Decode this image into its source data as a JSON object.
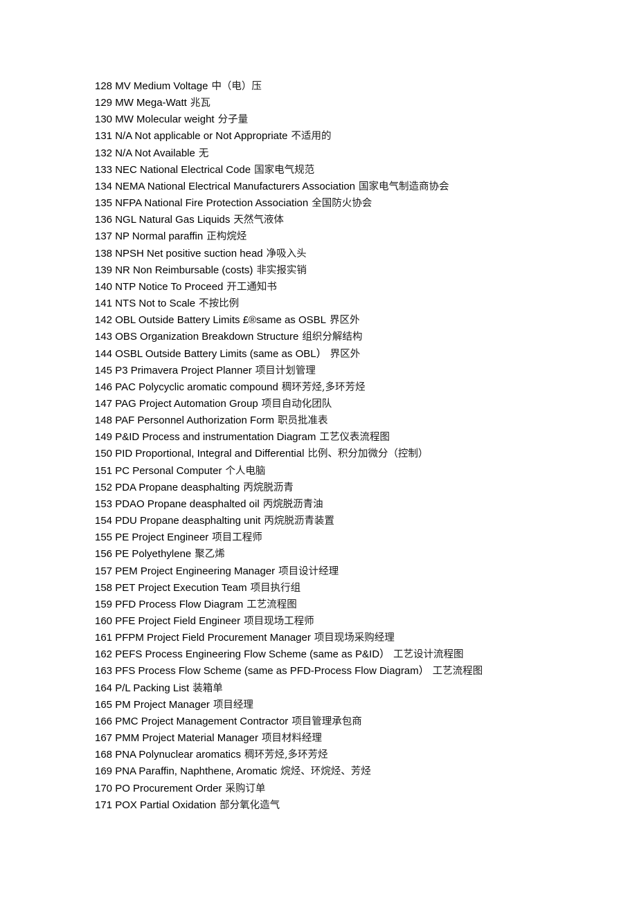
{
  "document": {
    "type": "bilingual-abbreviation-glossary",
    "language_pair": "English-Chinese",
    "first_index": 128,
    "last_index": 171,
    "entry_count": 44
  },
  "entries": [
    {
      "num": "128",
      "term": "MV Medium Voltage",
      "cn": "中（电）压"
    },
    {
      "num": "129",
      "term": "MW Mega-Watt",
      "cn": "兆瓦"
    },
    {
      "num": "130",
      "term": "MW Molecular weight",
      "cn": "分子量"
    },
    {
      "num": "131",
      "term": "N/A Not applicable or Not Appropriate",
      "cn": "不适用的"
    },
    {
      "num": "132",
      "term": "N/A Not Available",
      "cn": "无"
    },
    {
      "num": "133",
      "term": "NEC National Electrical Code",
      "cn": "国家电气规范"
    },
    {
      "num": "134",
      "term": "NEMA National Electrical Manufacturers Association",
      "cn": "国家电气制造商协会"
    },
    {
      "num": "135",
      "term": "NFPA National Fire Protection Association",
      "cn": "全国防火协会"
    },
    {
      "num": "136",
      "term": "NGL Natural Gas Liquids",
      "cn": "天然气液体"
    },
    {
      "num": "137",
      "term": "NP Normal paraffin",
      "cn": "正构烷烃"
    },
    {
      "num": "138",
      "term": "NPSH Net positive suction head",
      "cn": "净吸入头"
    },
    {
      "num": "139",
      "term": "NR Non Reimbursable (costs)",
      "cn": "非实报实销"
    },
    {
      "num": "140",
      "term": "NTP Notice To Proceed",
      "cn": "开工通知书"
    },
    {
      "num": "141",
      "term": "NTS Not to Scale",
      "cn": "不按比例"
    },
    {
      "num": "142",
      "term": "OBL Outside Battery Limits  £®same as OSBL",
      "cn": "界区外"
    },
    {
      "num": "143",
      "term": "OBS Organization Breakdown Structure",
      "cn": "组织分解结构"
    },
    {
      "num": "144",
      "term": "OSBL Outside Battery Limits (same as OBL）",
      "cn": "界区外"
    },
    {
      "num": "145",
      "term": "P3 Primavera Project Planner",
      "cn": "项目计划管理"
    },
    {
      "num": "146",
      "term": "PAC Polycyclic aromatic compound",
      "cn": "稠环芳烃,多环芳烃"
    },
    {
      "num": "147",
      "term": "PAG Project Automation Group",
      "cn": "项目自动化团队"
    },
    {
      "num": "148",
      "term": "PAF Personnel Authorization Form",
      "cn": "职员批准表"
    },
    {
      "num": "149",
      "term": "P&ID Process and instrumentation Diagram",
      "cn": "工艺仪表流程图"
    },
    {
      "num": "150",
      "term": "PID Proportional, Integral and Differential",
      "cn": "比例、积分加微分（控制）"
    },
    {
      "num": "151",
      "term": "PC Personal Computer",
      "cn": "个人电脑"
    },
    {
      "num": "152",
      "term": "PDA Propane deasphalting",
      "cn": "丙烷脱沥青"
    },
    {
      "num": "153",
      "term": "PDAO Propane deasphalted oil",
      "cn": "丙烷脱沥青油"
    },
    {
      "num": "154",
      "term": "PDU Propane deasphalting unit",
      "cn": "丙烷脱沥青装置"
    },
    {
      "num": "155",
      "term": "PE Project Engineer",
      "cn": "项目工程师"
    },
    {
      "num": "156",
      "term": "PE Polyethylene",
      "cn": "聚乙烯"
    },
    {
      "num": "157",
      "term": "PEM Project Engineering Manager",
      "cn": "项目设计经理"
    },
    {
      "num": "158",
      "term": "PET Project Execution Team",
      "cn": "项目执行组"
    },
    {
      "num": "159",
      "term": "PFD Process Flow Diagram",
      "cn": "工艺流程图"
    },
    {
      "num": "160",
      "term": "PFE Project Field Engineer",
      "cn": "项目现场工程师"
    },
    {
      "num": "161",
      "term": "PFPM Project Field Procurement Manager",
      "cn": "项目现场采购经理"
    },
    {
      "num": "162",
      "term": "PEFS Process Engineering Flow Scheme (same as P&ID）",
      "cn": "工艺设计流程图"
    },
    {
      "num": "163",
      "term": "PFS Process Flow Scheme (same as PFD-Process Flow Diagram）",
      "cn": "工艺流程图"
    },
    {
      "num": "164",
      "term": "P/L Packing List",
      "cn": "装箱单"
    },
    {
      "num": "165",
      "term": "PM Project Manager",
      "cn": "项目经理"
    },
    {
      "num": "166",
      "term": "PMC Project Management Contractor",
      "cn": "项目管理承包商"
    },
    {
      "num": "167",
      "term": "PMM Project Material Manager",
      "cn": "项目材料经理"
    },
    {
      "num": "168",
      "term": "PNA Polynuclear aromatics",
      "cn": "稠环芳烃,多环芳烃"
    },
    {
      "num": "169",
      "term": "PNA Paraffin, Naphthene, Aromatic",
      "cn": "烷烃、环烷烃、芳烃"
    },
    {
      "num": "170",
      "term": "PO Procurement Order",
      "cn": "采购订单"
    },
    {
      "num": "171",
      "term": "POX Partial Oxidation",
      "cn": "部分氧化造气"
    }
  ]
}
